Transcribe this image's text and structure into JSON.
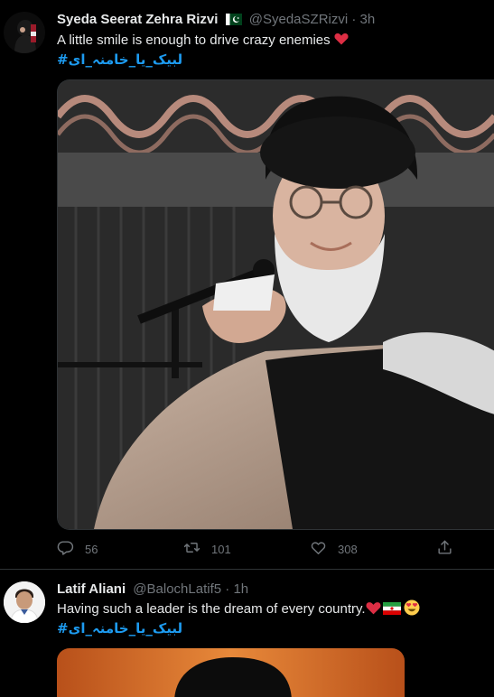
{
  "tweets": [
    {
      "author_name": "Syeda Seerat Zehra Rizvi",
      "handle": "@SyedaSZRizvi",
      "separator": "·",
      "time": "3h",
      "text": "A little smile is enough to drive crazy enemies ",
      "hashtag": "#لبیک_یا_خامنہ_ای",
      "actions": {
        "reply_count": "56",
        "retweet_count": "101",
        "like_count": "308"
      }
    },
    {
      "author_name": "Latif Aliani",
      "handle": "@BalochLatif5",
      "separator": "·",
      "time": "1h",
      "text": "Having such a leader is the dream of every country.",
      "hashtag": "#لبیک_یا_خامنہ_ای"
    }
  ],
  "colors": {
    "background": "#000000",
    "text_primary": "#e7e9ea",
    "text_secondary": "#71767b",
    "link": "#1d9bf0",
    "heart": "#f91880",
    "divider": "#2f3336"
  },
  "icons": {
    "flag": "pakistan-flag-icon",
    "reply": "reply-icon",
    "retweet": "retweet-icon",
    "like": "heart-icon",
    "share": "share-icon",
    "heart_emoji": "red-heart-icon",
    "iran_flag": "iran-flag-icon",
    "heart_eyes": "heart-eyes-emoji-icon"
  }
}
